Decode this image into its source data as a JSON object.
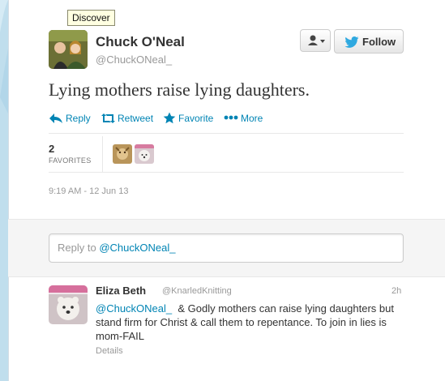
{
  "tooltip": {
    "text": "Discover"
  },
  "tweet": {
    "fullname": "Chuck O'Neal",
    "screen_name": "@ChuckONeal_",
    "text": "Lying mothers raise lying daughters.",
    "timestamp": "9:19 AM - 12 Jun 13"
  },
  "header_buttons": {
    "follow_label": "Follow",
    "user_dropdown_icon": "user-icon"
  },
  "actions": [
    {
      "label": "Reply",
      "icon": "reply-icon"
    },
    {
      "label": "Retweet",
      "icon": "retweet-icon"
    },
    {
      "label": "Favorite",
      "icon": "star-icon"
    },
    {
      "label": "More",
      "icon": "more-dots-icon"
    }
  ],
  "stats": {
    "favorites_count": "2",
    "favorites_label": "FAVORITES"
  },
  "reply_box": {
    "prefix": "Reply to ",
    "mention": "@ChuckONeal_"
  },
  "reply": {
    "name": "Eliza Beth",
    "handle": "@KnarledKnitting",
    "time": "2h",
    "mention": "@ChuckONeal_",
    "text": "  & Godly mothers can raise lying daughters but stand firm for Christ & call them to repentance. To join in lies is mom-FAIL",
    "details_label": "Details"
  },
  "colors": {
    "background": "#c0deed",
    "link": "#0084b4",
    "twitter_blue": "#2fa9e0"
  }
}
